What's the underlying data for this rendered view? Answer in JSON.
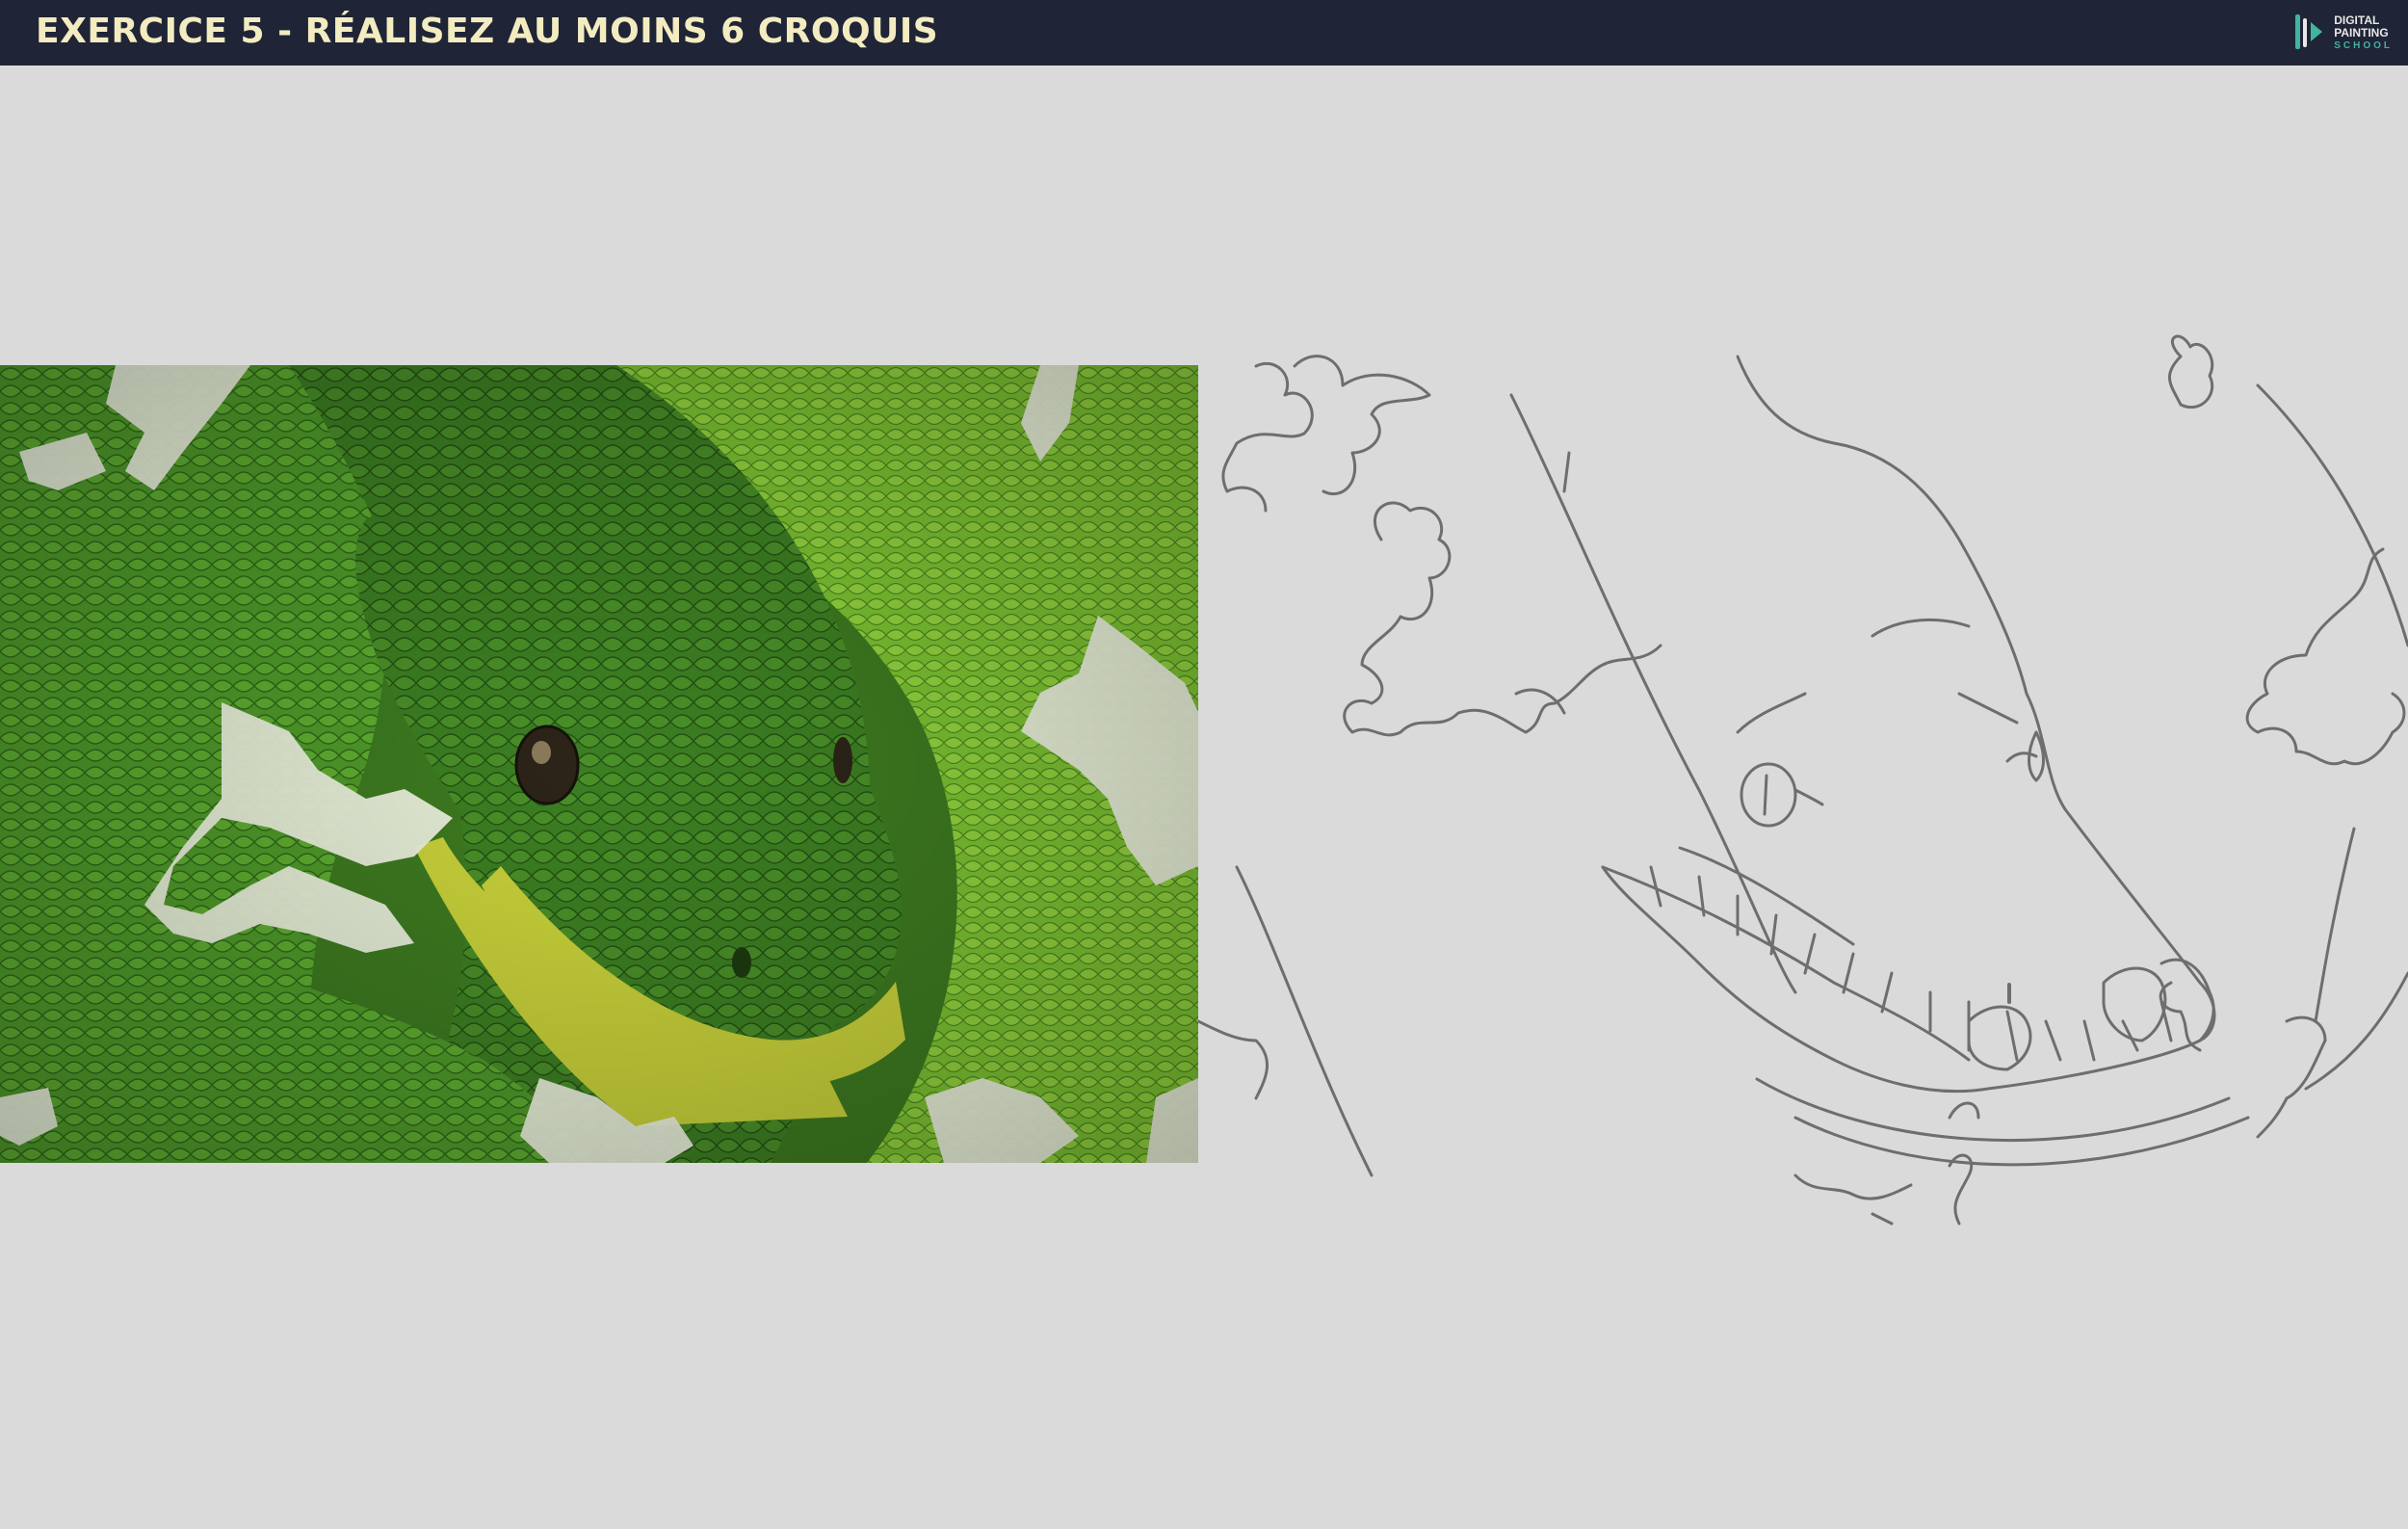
{
  "header": {
    "title": "EXERCICE 5 - RÉALISEZ AU MOINS 6 CROQUIS",
    "logo": {
      "line1": "DIGITAL",
      "line2": "PAINTING",
      "line3": "SCHOOL"
    }
  },
  "colors": {
    "header_bg": "#1f2436",
    "title": "#f3ecc0",
    "canvas_bg": "#dadada",
    "logo_accent": "#3fb5a0",
    "snake_green": "#4f9a2a",
    "snake_light": "#9fd63c",
    "snake_belly": "#c9d23a",
    "pattern_white": "#eef3e0",
    "sketch_stroke": "#6e6e6e"
  },
  "reference_photo": {
    "icon": "green-tree-python-photo"
  },
  "sketch": {
    "icon": "python-line-sketch"
  }
}
